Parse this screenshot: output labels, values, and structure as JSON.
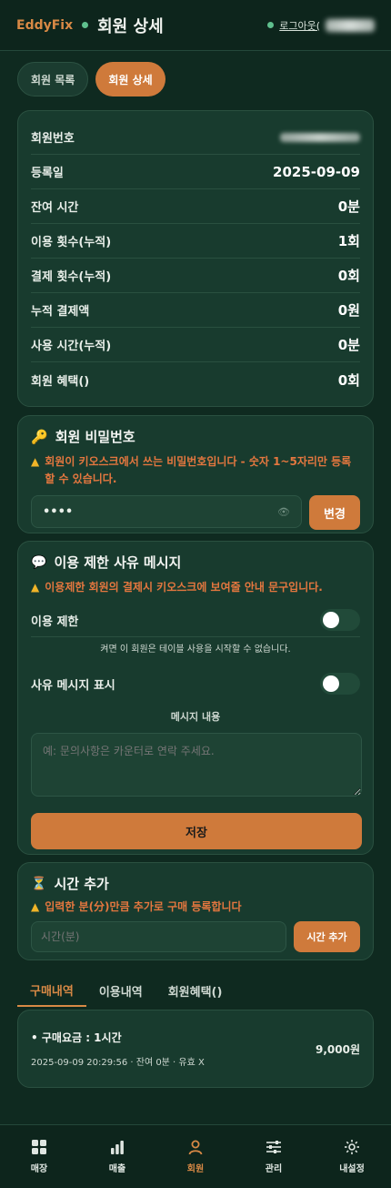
{
  "header": {
    "brand": "EddyFix",
    "title": "회원 상세",
    "logout": "로그아웃("
  },
  "top_tabs": [
    {
      "label": "회원 목록"
    },
    {
      "label": "회원 상세"
    }
  ],
  "info_rows": [
    {
      "label": "회원번호",
      "value": ""
    },
    {
      "label": "등록일",
      "value": "2025-09-09"
    },
    {
      "label": "잔여 시간",
      "value": "0분"
    },
    {
      "label": "이용 횟수(누적)",
      "value": "1회"
    },
    {
      "label": "결제 횟수(누적)",
      "value": "0회"
    },
    {
      "label": "누적 결제액",
      "value": "0원"
    },
    {
      "label": "사용 시간(누적)",
      "value": "0분"
    },
    {
      "label": "회원 혜택()",
      "value": "0회"
    }
  ],
  "password": {
    "title": "회원 비밀번호",
    "warning": "회원이 키오스크에서 쓰는 비밀번호입니다 - 숫자 1~5자리만 등록할 수 있습니다.",
    "value": "••••",
    "button": "변경"
  },
  "restriction": {
    "title": "이용 제한 사유 메시지",
    "warning": "이용제한 회원의 결제시 키오스크에 보여줄 안내 문구입니다.",
    "toggle_label": "이용 제한",
    "toggle_hint": "켜면 이 회원은 테이블 사용을 시작할 수 없습니다.",
    "show_label": "사유 메시지 표시",
    "message_label": "메시지 내용",
    "message_placeholder": "예: 문의사항은 카운터로 연락 주세요.",
    "save": "저장"
  },
  "add_time": {
    "title": "시간 추가",
    "warning": "입력한 분(分)만큼 추가로 구매 등록합니다",
    "placeholder": "시간(분)",
    "button": "시간 추가"
  },
  "history_tabs": [
    {
      "label": "구매내역"
    },
    {
      "label": "이용내역"
    },
    {
      "label": "회원혜택()"
    }
  ],
  "purchase": {
    "title": "구매요금 : 1시간",
    "meta": "2025-09-09 20:29:56 · 잔여 0분 · 유효 X",
    "amount": "9,000원"
  },
  "nav": [
    {
      "label": "매장"
    },
    {
      "label": "매출"
    },
    {
      "label": "회원"
    },
    {
      "label": "관리"
    },
    {
      "label": "내설정"
    }
  ],
  "colors": {
    "accent": "#cf7a3b",
    "background": "#0f2a20",
    "card": "#183b2e",
    "warning": "#e4773f",
    "online": "#5fc08e"
  }
}
